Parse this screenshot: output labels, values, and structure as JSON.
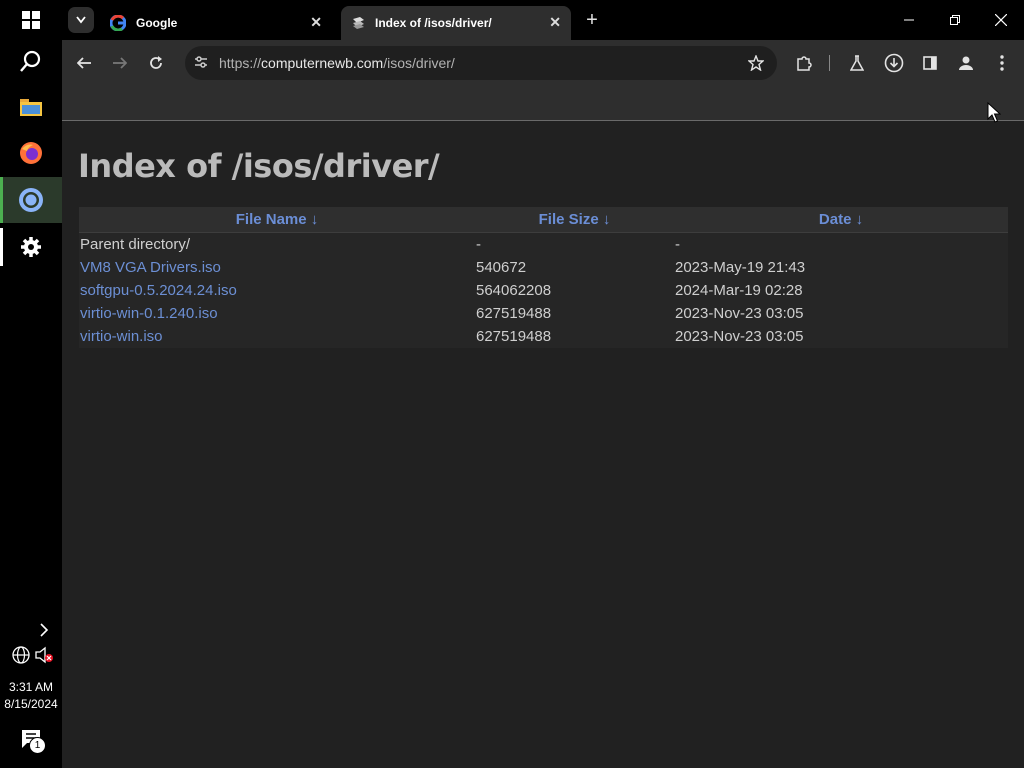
{
  "taskbar": {
    "time": "3:31 AM",
    "date": "8/15/2024",
    "notification_count": "1"
  },
  "tabs": [
    {
      "title": "Google",
      "active": false
    },
    {
      "title": "Index of /isos/driver/",
      "active": true
    }
  ],
  "toolbar": {
    "url_scheme": "https://",
    "url_host": "computernewb.com",
    "url_path": "/isos/driver/"
  },
  "page": {
    "heading": "Index of /isos/driver/",
    "columns": [
      "File Name  ↓",
      "File Size  ↓",
      "Date  ↓"
    ],
    "rows": [
      {
        "name": "Parent directory/",
        "size": "-",
        "date": "-",
        "link": false
      },
      {
        "name": "VM8 VGA Drivers.iso",
        "size": "540672",
        "date": "2023-May-19 21:43",
        "link": true
      },
      {
        "name": "softgpu-0.5.2024.24.iso",
        "size": "564062208",
        "date": "2024-Mar-19 02:28",
        "link": true
      },
      {
        "name": "virtio-win-0.1.240.iso",
        "size": "627519488",
        "date": "2023-Nov-23 03:05",
        "link": true
      },
      {
        "name": "virtio-win.iso",
        "size": "627519488",
        "date": "2023-Nov-23 03:05",
        "link": true
      }
    ]
  },
  "colors": {
    "link": "#6c8fd4",
    "header_text": "#6b8ed6",
    "page_bg": "#212121"
  }
}
